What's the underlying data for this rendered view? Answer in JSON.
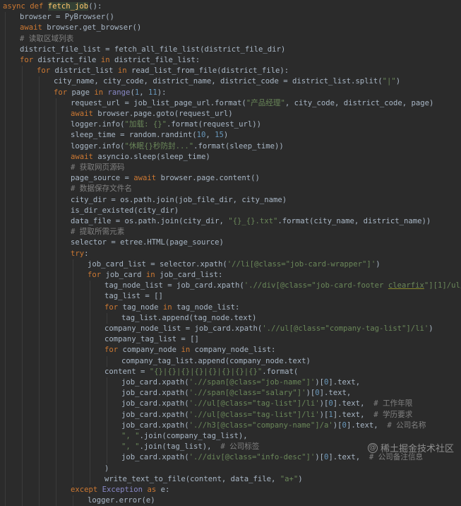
{
  "code_lines": [
    {
      "indent": 0,
      "tokens": [
        {
          "t": "async def ",
          "c": "kw"
        },
        {
          "t": "fetch_job",
          "c": "fn hl"
        },
        {
          "t": "():"
        }
      ]
    },
    {
      "indent": 1,
      "tokens": [
        {
          "t": "browser = PyBrowser()"
        }
      ]
    },
    {
      "indent": 1,
      "tokens": [
        {
          "t": "await ",
          "c": "kw"
        },
        {
          "t": "browser.get_browser()"
        }
      ]
    },
    {
      "indent": 1,
      "tokens": [
        {
          "t": "# 读取区域列表",
          "c": "cm"
        }
      ]
    },
    {
      "indent": 1,
      "tokens": [
        {
          "t": "district_file_list = fetch_all_file_list(district_file_dir)"
        }
      ]
    },
    {
      "indent": 1,
      "tokens": [
        {
          "t": "for ",
          "c": "kw"
        },
        {
          "t": "district_file "
        },
        {
          "t": "in ",
          "c": "kw"
        },
        {
          "t": "district_file_list:"
        }
      ]
    },
    {
      "indent": 2,
      "tokens": [
        {
          "t": "for ",
          "c": "kw"
        },
        {
          "t": "district_list "
        },
        {
          "t": "in ",
          "c": "kw"
        },
        {
          "t": "read_list_from_file(district_file):"
        }
      ]
    },
    {
      "indent": 3,
      "tokens": [
        {
          "t": "city_name, city_code, district_name, district_code = district_list.split("
        },
        {
          "t": "\"|\"",
          "c": "str"
        },
        {
          "t": ")"
        }
      ]
    },
    {
      "indent": 3,
      "tokens": [
        {
          "t": "for ",
          "c": "kw"
        },
        {
          "t": "page "
        },
        {
          "t": "in ",
          "c": "kw"
        },
        {
          "t": "range",
          "c": "blt"
        },
        {
          "t": "("
        },
        {
          "t": "1",
          "c": "num"
        },
        {
          "t": ", "
        },
        {
          "t": "11",
          "c": "num"
        },
        {
          "t": "):"
        }
      ]
    },
    {
      "indent": 4,
      "tokens": [
        {
          "t": "request_url = job_list_page_url.format("
        },
        {
          "t": "\"产品经理\"",
          "c": "str"
        },
        {
          "t": ", city_code, district_code, page)"
        }
      ]
    },
    {
      "indent": 4,
      "tokens": [
        {
          "t": "await ",
          "c": "kw"
        },
        {
          "t": "browser.page.goto(request_url)"
        }
      ]
    },
    {
      "indent": 4,
      "tokens": [
        {
          "t": "logger.info("
        },
        {
          "t": "\"加载: {}\"",
          "c": "str"
        },
        {
          "t": ".format(request_url))"
        }
      ]
    },
    {
      "indent": 4,
      "tokens": [
        {
          "t": "sleep_time = random.randint("
        },
        {
          "t": "10",
          "c": "num"
        },
        {
          "t": ", "
        },
        {
          "t": "15",
          "c": "num"
        },
        {
          "t": ")"
        }
      ]
    },
    {
      "indent": 4,
      "tokens": [
        {
          "t": "logger.info("
        },
        {
          "t": "\"休眠{}秒防封...\"",
          "c": "str"
        },
        {
          "t": ".format(sleep_time))"
        }
      ]
    },
    {
      "indent": 4,
      "tokens": [
        {
          "t": "await ",
          "c": "kw"
        },
        {
          "t": "asyncio.sleep(sleep_time)"
        }
      ]
    },
    {
      "indent": 4,
      "tokens": [
        {
          "t": "# 获取网页源码",
          "c": "cm"
        }
      ]
    },
    {
      "indent": 4,
      "tokens": [
        {
          "t": "page_source = "
        },
        {
          "t": "await ",
          "c": "kw"
        },
        {
          "t": "browser.page.content()"
        }
      ]
    },
    {
      "indent": 4,
      "tokens": [
        {
          "t": "# 数据保存文件名",
          "c": "cm"
        }
      ]
    },
    {
      "indent": 4,
      "tokens": [
        {
          "t": "city_dir = os.path.join(job_file_dir, city_name)"
        }
      ]
    },
    {
      "indent": 4,
      "tokens": [
        {
          "t": "is_dir_existed(city_dir)"
        }
      ]
    },
    {
      "indent": 4,
      "tokens": [
        {
          "t": "data_file = os.path.join(city_dir, "
        },
        {
          "t": "\"{}_{}.txt\"",
          "c": "str"
        },
        {
          "t": ".format(city_name, district_name))"
        }
      ]
    },
    {
      "indent": 4,
      "tokens": [
        {
          "t": "# 提取所需元素",
          "c": "cm"
        }
      ]
    },
    {
      "indent": 4,
      "tokens": [
        {
          "t": "selector = etree.HTML(page_source)"
        }
      ]
    },
    {
      "indent": 4,
      "tokens": [
        {
          "t": "try",
          "c": "kw"
        },
        {
          "t": ":"
        }
      ]
    },
    {
      "indent": 5,
      "tokens": [
        {
          "t": "job_card_list = selector.xpath("
        },
        {
          "t": "'//li[@class=\"job-card-wrapper\"]'",
          "c": "str"
        },
        {
          "t": ")"
        }
      ]
    },
    {
      "indent": 5,
      "tokens": [
        {
          "t": "for ",
          "c": "kw"
        },
        {
          "t": "job_card "
        },
        {
          "t": "in ",
          "c": "kw"
        },
        {
          "t": "job_card_list:"
        }
      ]
    },
    {
      "indent": 6,
      "tokens": [
        {
          "t": "tag_node_list = job_card.xpath("
        },
        {
          "t": "'.//div[@class=\"job-card-footer ",
          "c": "str"
        },
        {
          "t": "clearfix",
          "c": "str und"
        },
        {
          "t": "\"]",
          "c": "str"
        },
        {
          "t": "[1]",
          "c": "str"
        },
        {
          "t": "/ul/li'",
          "c": "str"
        },
        {
          "t": ")"
        }
      ]
    },
    {
      "indent": 6,
      "tokens": [
        {
          "t": "tag_list = []"
        }
      ]
    },
    {
      "indent": 6,
      "tokens": [
        {
          "t": "for ",
          "c": "kw"
        },
        {
          "t": "tag_node "
        },
        {
          "t": "in ",
          "c": "kw"
        },
        {
          "t": "tag_node_list:"
        }
      ]
    },
    {
      "indent": 7,
      "tokens": [
        {
          "t": "tag_list.append(tag_node.text)"
        }
      ]
    },
    {
      "indent": 6,
      "tokens": [
        {
          "t": "company_node_list = job_card.xpath("
        },
        {
          "t": "'.//ul[@class=\"company-tag-list\"]/li'",
          "c": "str"
        },
        {
          "t": ")"
        }
      ]
    },
    {
      "indent": 6,
      "tokens": [
        {
          "t": "company_tag_list = []"
        }
      ]
    },
    {
      "indent": 6,
      "tokens": [
        {
          "t": "for ",
          "c": "kw"
        },
        {
          "t": "company_node "
        },
        {
          "t": "in ",
          "c": "kw"
        },
        {
          "t": "company_node_list:"
        }
      ]
    },
    {
      "indent": 7,
      "tokens": [
        {
          "t": "company_tag_list.append(company_node.text)"
        }
      ]
    },
    {
      "indent": 6,
      "tokens": [
        {
          "t": "content = "
        },
        {
          "t": "\"{}|{}|{}|{}|{}|{}|{}|{}\"",
          "c": "str"
        },
        {
          "t": ".format("
        }
      ]
    },
    {
      "indent": 7,
      "tokens": [
        {
          "t": "job_card.xpath("
        },
        {
          "t": "'.//span[@class=\"job-name\"]'",
          "c": "str"
        },
        {
          "t": ")["
        },
        {
          "t": "0",
          "c": "num"
        },
        {
          "t": "].text,"
        }
      ]
    },
    {
      "indent": 7,
      "tokens": [
        {
          "t": "job_card.xpath("
        },
        {
          "t": "'.//span[@class=\"salary\"]'",
          "c": "str"
        },
        {
          "t": ")["
        },
        {
          "t": "0",
          "c": "num"
        },
        {
          "t": "].text,"
        }
      ]
    },
    {
      "indent": 7,
      "tokens": [
        {
          "t": "job_card.xpath("
        },
        {
          "t": "'.//ul[@class=\"tag-list\"]/li'",
          "c": "str"
        },
        {
          "t": ")["
        },
        {
          "t": "0",
          "c": "num"
        },
        {
          "t": "].text,  "
        },
        {
          "t": "# 工作年限",
          "c": "cm"
        }
      ]
    },
    {
      "indent": 7,
      "tokens": [
        {
          "t": "job_card.xpath("
        },
        {
          "t": "'.//ul[@class=\"tag-list\"]/li'",
          "c": "str"
        },
        {
          "t": ")["
        },
        {
          "t": "1",
          "c": "num"
        },
        {
          "t": "].text,  "
        },
        {
          "t": "# 学历要求",
          "c": "cm"
        }
      ]
    },
    {
      "indent": 7,
      "tokens": [
        {
          "t": "job_card.xpath("
        },
        {
          "t": "'.//h3[@class=\"company-name\"]/a'",
          "c": "str"
        },
        {
          "t": ")["
        },
        {
          "t": "0",
          "c": "num"
        },
        {
          "t": "].text,  "
        },
        {
          "t": "# 公司名称",
          "c": "cm"
        }
      ]
    },
    {
      "indent": 7,
      "tokens": [
        {
          "t": "\", \"",
          "c": "str"
        },
        {
          "t": ".join(company_tag_list),"
        }
      ]
    },
    {
      "indent": 7,
      "tokens": [
        {
          "t": "\", \"",
          "c": "str"
        },
        {
          "t": ".join(tag_list),  "
        },
        {
          "t": "# 公司标签",
          "c": "cm"
        }
      ]
    },
    {
      "indent": 7,
      "tokens": [
        {
          "t": "job_card.xpath("
        },
        {
          "t": "'.//div[@class=\"info-desc\"]'",
          "c": "str"
        },
        {
          "t": ")["
        },
        {
          "t": "0",
          "c": "num"
        },
        {
          "t": "].text,  "
        },
        {
          "t": "# 公司备注信息",
          "c": "cm"
        }
      ]
    },
    {
      "indent": 6,
      "tokens": [
        {
          "t": ")"
        }
      ]
    },
    {
      "indent": 6,
      "tokens": [
        {
          "t": "write_text_to_file(content, data_file, "
        },
        {
          "t": "\"a+\"",
          "c": "str"
        },
        {
          "t": ")"
        }
      ]
    },
    {
      "indent": 4,
      "tokens": [
        {
          "t": "except ",
          "c": "kw"
        },
        {
          "t": "Exception ",
          "c": "blt"
        },
        {
          "t": "as ",
          "c": "kw"
        },
        {
          "t": "e:"
        }
      ]
    },
    {
      "indent": 5,
      "tokens": [
        {
          "t": "logger.error(e)"
        }
      ]
    }
  ],
  "watermark": {
    "icon": "juejin-logo-icon",
    "text": "稀土掘金技术社区"
  },
  "colors": {
    "background": "#2b2b2b",
    "text": "#a9b7c6",
    "keyword": "#cc7832",
    "function": "#ffc66d",
    "string": "#6a8759",
    "number": "#6897bb",
    "comment": "#808080",
    "builtin": "#8888c6"
  }
}
